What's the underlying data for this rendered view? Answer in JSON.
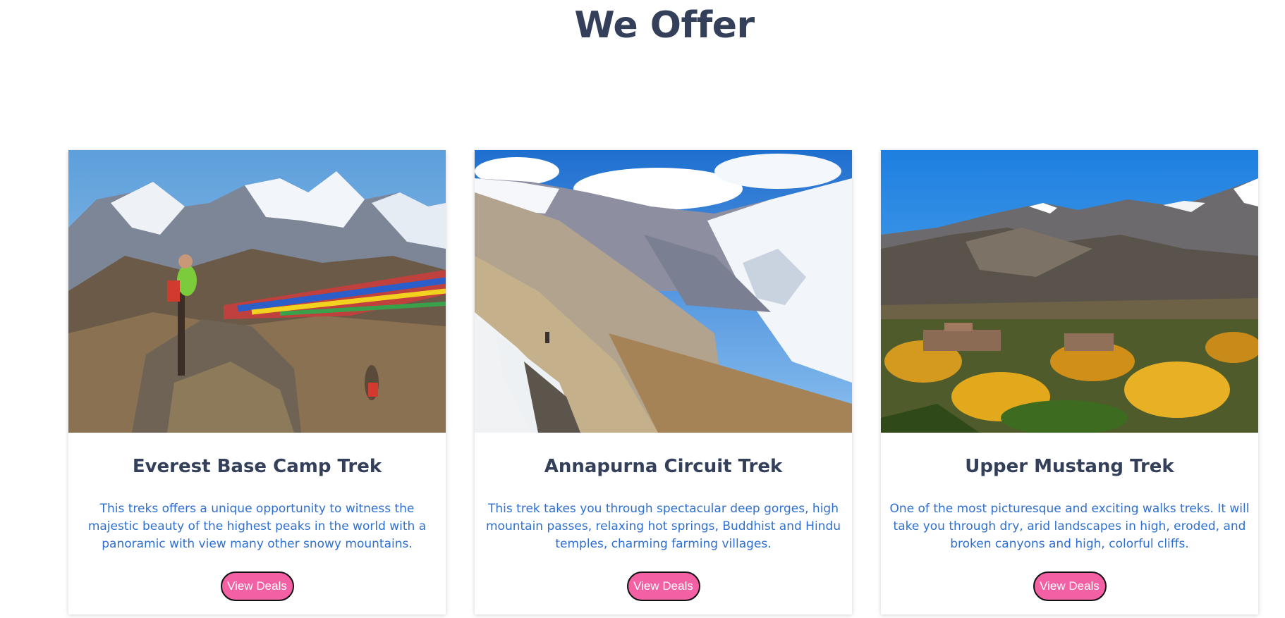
{
  "section": {
    "title": "We Offer"
  },
  "cards": [
    {
      "title": "Everest Base Camp Trek",
      "description": "This treks offers a unique opportunity to witness the majestic beauty of the highest peaks in the world with a panoramic with view many other snowy mountains.",
      "button_label": "View Deals"
    },
    {
      "title": "Annapurna Circuit Trek",
      "description": "This trek takes you through spectacular deep gorges, high mountain passes, relaxing hot springs, Buddhist and Hindu temples, charming farming villages.",
      "button_label": "View Deals"
    },
    {
      "title": "Upper Mustang Trek",
      "description": "One of the most picturesque and exciting walks treks. It will take you through dry, arid landscapes in high, eroded, and broken canyons and high, colorful cliffs.",
      "button_label": "View Deals"
    }
  ],
  "colors": {
    "heading": "#34405a",
    "description": "#2f6fcf",
    "button_background": "#f360a4",
    "button_text": "#ffffff"
  }
}
